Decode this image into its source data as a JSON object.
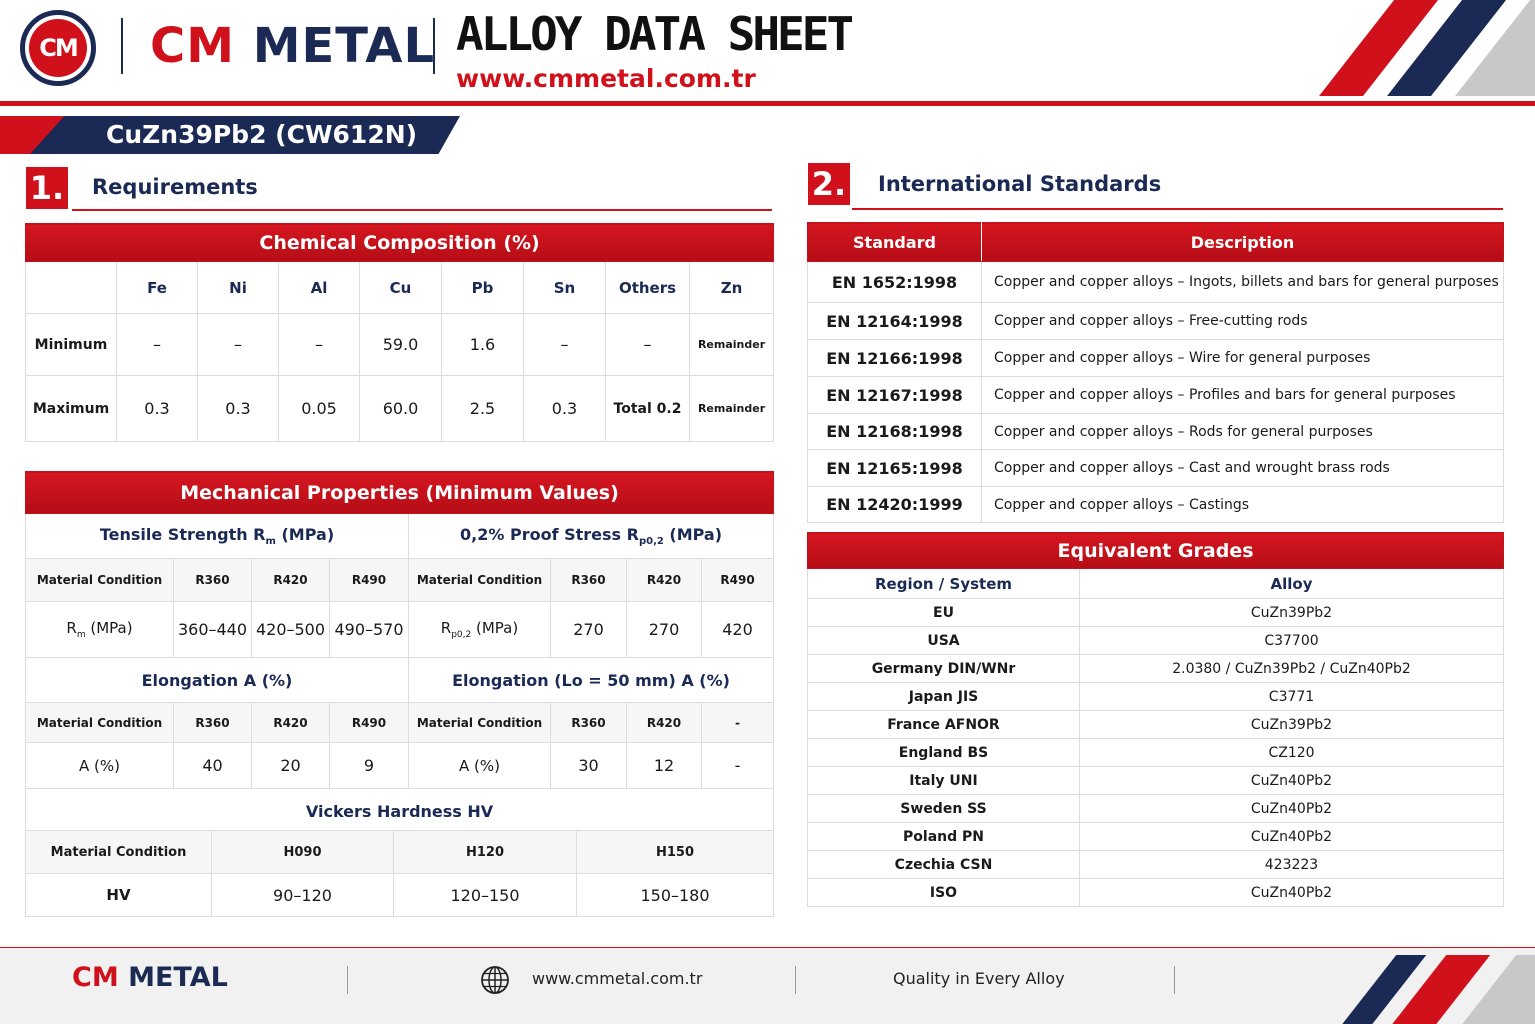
{
  "header": {
    "logo_text": "CM",
    "brand_cm": "CM",
    "brand_metal": "METAL",
    "title": "ALLOY DATA SHEET",
    "url": "www.cmmetal.com.tr",
    "colors": {
      "red": "#d0111b",
      "navy": "#1b2a55",
      "gray": "#c8c8c8"
    }
  },
  "alloy": {
    "name": "CuZn39Pb2 (CW612N)"
  },
  "section1": {
    "number": "1.",
    "title": "Requirements"
  },
  "section2": {
    "number": "2.",
    "title": "International Standards"
  },
  "chemical": {
    "title": "Chemical Composition (%)",
    "columns": [
      "Fe",
      "Ni",
      "Al",
      "Cu",
      "Pb",
      "Sn",
      "Others",
      "Zn"
    ],
    "rows": [
      {
        "label": "Minimum",
        "values": [
          "–",
          "–",
          "–",
          "59.0",
          "1.6",
          "–",
          "–",
          "Remainder"
        ]
      },
      {
        "label": "Maximum",
        "values": [
          "0.3",
          "0.3",
          "0.05",
          "60.0",
          "2.5",
          "0.3",
          "Total 0.2",
          "Remainder"
        ]
      }
    ]
  },
  "mechanical": {
    "title": "Mechanical Properties (Minimum Values)",
    "tensile": {
      "title_main": "Tensile Strength R",
      "title_sub": "m",
      "title_unit": " (MPa)",
      "cond": "Material Condition",
      "cols": [
        "R360",
        "R420",
        "R490"
      ],
      "row_label_main": "R",
      "row_label_sub": "m",
      "row_label_unit": " (MPa)",
      "values": [
        "360–440",
        "420–500",
        "490–570"
      ]
    },
    "proof": {
      "title_main": "0,2% Proof Stress R",
      "title_sub": "p0,2",
      "title_unit": " (MPa)",
      "cond": "Material Condition",
      "cols": [
        "R360",
        "R420",
        "R490"
      ],
      "row_label_main": "R",
      "row_label_sub": "p0,2",
      "row_label_unit": " (MPa)",
      "values": [
        "270",
        "270",
        "420"
      ]
    },
    "elong": {
      "title": "Elongation A (%)",
      "cond": "Material Condition",
      "cols": [
        "R360",
        "R420",
        "R490"
      ],
      "row_label": "A (%)",
      "values": [
        "40",
        "20",
        "9"
      ]
    },
    "elong50": {
      "title": "Elongation (Lo = 50 mm) A (%)",
      "cond": "Material Condition",
      "cols": [
        "R360",
        "R420",
        "-"
      ],
      "row_label": "A (%)",
      "values": [
        "30",
        "12",
        "-"
      ]
    },
    "hardness": {
      "title": "Vickers Hardness HV",
      "cond": "Material Condition",
      "cols": [
        "H090",
        "H120",
        "H150"
      ],
      "row_label": "HV",
      "values": [
        "90–120",
        "120–150",
        "150–180"
      ]
    }
  },
  "standards": {
    "headers": [
      "Standard",
      "Description"
    ],
    "rows": [
      [
        "EN 1652:1998",
        "Copper and copper alloys – Ingots, billets and bars for general purposes"
      ],
      [
        "EN 12164:1998",
        "Copper and copper alloys – Free-cutting rods"
      ],
      [
        "EN 12166:1998",
        "Copper and copper alloys – Wire for general purposes"
      ],
      [
        "EN 12167:1998",
        "Copper and copper alloys – Profiles and bars for general purposes"
      ],
      [
        "EN 12168:1998",
        "Copper and copper alloys – Rods for general purposes"
      ],
      [
        "EN 12165:1998",
        "Copper and copper alloys – Cast and wrought brass rods"
      ],
      [
        "EN 12420:1999",
        "Copper and copper alloys – Castings"
      ]
    ]
  },
  "equivalents": {
    "title": "Equivalent Grades",
    "headers": [
      "Region / System",
      "Alloy"
    ],
    "rows": [
      [
        "EU",
        "CuZn39Pb2"
      ],
      [
        "USA",
        "C37700"
      ],
      [
        "Germany DIN/WNr",
        "2.0380 / CuZn39Pb2 / CuZn40Pb2"
      ],
      [
        "Japan JIS",
        "C3771"
      ],
      [
        "France AFNOR",
        "CuZn39Pb2"
      ],
      [
        "England BS",
        "CZ120"
      ],
      [
        "Italy UNI",
        "CuZn40Pb2"
      ],
      [
        "Sweden SS",
        "CuZn40Pb2"
      ],
      [
        "Poland PN",
        "CuZn40Pb2"
      ],
      [
        "Czechia CSN",
        "423223"
      ],
      [
        "ISO",
        "CuZn40Pb2"
      ]
    ]
  },
  "footer": {
    "brand_cm": "CM",
    "brand_metal": "METAL",
    "url": "www.cmmetal.com.tr",
    "tagline": "Quality in Every Alloy",
    "icon": "globe-icon"
  }
}
